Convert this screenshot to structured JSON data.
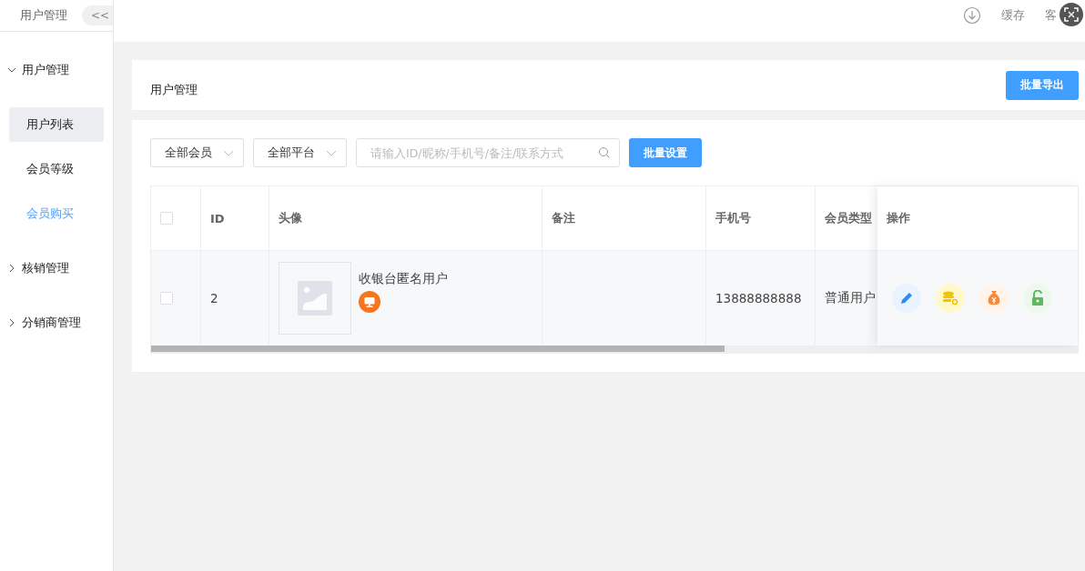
{
  "sidebar": {
    "title": "用户管理",
    "collapse_label": "<<",
    "groups": [
      {
        "label": "用户管理",
        "expanded": true,
        "children": [
          {
            "label": "用户列表",
            "selected": true,
            "hovered": false
          },
          {
            "label": "会员等级",
            "selected": false,
            "hovered": false
          },
          {
            "label": "会员购买",
            "selected": false,
            "hovered": true
          }
        ]
      },
      {
        "label": "核销管理",
        "expanded": false
      },
      {
        "label": "分销商管理",
        "expanded": false
      }
    ]
  },
  "topbar": {
    "links": [
      "缓存",
      "客"
    ]
  },
  "page": {
    "title": "用户管理",
    "export_button": "批量导出"
  },
  "filters": {
    "member_select": "全部会员",
    "platform_select": "全部平台",
    "search": {
      "placeholder": "请输入ID/昵称/手机号/备注/联系方式"
    },
    "batch_button": "批量设置"
  },
  "table": {
    "columns": [
      "ID",
      "头像",
      "备注",
      "手机号",
      "会员类型",
      "操作"
    ],
    "rows": [
      {
        "checked": false,
        "id": "2",
        "nickname": "收银台匿名用户",
        "phone": "13888888888",
        "member_type": "普通用户"
      }
    ],
    "header_checked": false,
    "actions": [
      {
        "kind": "edit",
        "color": "#2d8cf0"
      },
      {
        "kind": "coins",
        "color": "#f5c400"
      },
      {
        "kind": "moneybag",
        "color": "#f7893b"
      },
      {
        "kind": "unlock",
        "color": "#5fb85f"
      }
    ]
  }
}
